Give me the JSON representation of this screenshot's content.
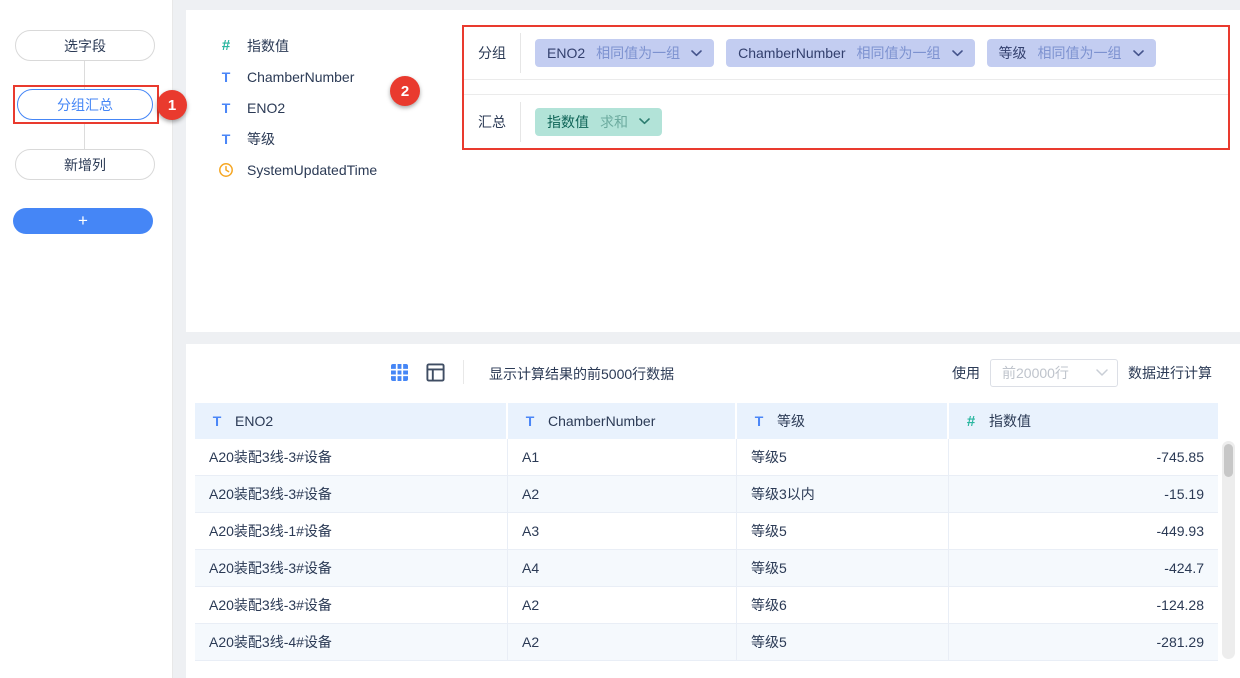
{
  "annotations": {
    "step1": "1",
    "step2": "2"
  },
  "sidebar": {
    "items": [
      {
        "label": "选字段"
      },
      {
        "label": "分组汇总"
      },
      {
        "label": "新增列"
      }
    ],
    "add_label": "+"
  },
  "fields": [
    {
      "name": "指数值",
      "type": "number"
    },
    {
      "name": "ChamberNumber",
      "type": "text"
    },
    {
      "name": "ENO2",
      "type": "text"
    },
    {
      "name": "等级",
      "type": "text"
    },
    {
      "name": "SystemUpdatedTime",
      "type": "datetime"
    }
  ],
  "group_panel": {
    "group_label": "分组",
    "group_tags": [
      {
        "field": "ENO2",
        "rule": "相同值为一组"
      },
      {
        "field": "ChamberNumber",
        "rule": "相同值为一组"
      },
      {
        "field": "等级",
        "rule": "相同值为一组"
      }
    ],
    "summary_label": "汇总",
    "summary_tags": [
      {
        "field": "指数值",
        "rule": "求和"
      }
    ]
  },
  "toolbar": {
    "result_info": "显示计算结果的前5000行数据",
    "use_prefix": "使用",
    "rows_select_value": "前20000行",
    "use_suffix": "数据进行计算"
  },
  "table": {
    "columns": [
      {
        "label": "ENO2",
        "type": "text"
      },
      {
        "label": "ChamberNumber",
        "type": "text"
      },
      {
        "label": "等级",
        "type": "text"
      },
      {
        "label": "指数值",
        "type": "number"
      }
    ],
    "rows": [
      [
        "A20装配3线-3#设备",
        "A1",
        "等级5",
        "-745.85"
      ],
      [
        "A20装配3线-3#设备",
        "A2",
        "等级3以内",
        "-15.19"
      ],
      [
        "A20装配3线-1#设备",
        "A3",
        "等级5",
        "-449.93"
      ],
      [
        "A20装配3线-3#设备",
        "A4",
        "等级5",
        "-424.7"
      ],
      [
        "A20装配3线-3#设备",
        "A2",
        "等级6",
        "-124.28"
      ],
      [
        "A20装配3线-4#设备",
        "A2",
        "等级5",
        "-281.29"
      ]
    ]
  },
  "colors": {
    "accent_blue": "#4586f6",
    "teal": "#2ab6a0",
    "orange": "#f5a623",
    "annotation_red": "#e93a2e",
    "group_tag_bg": "#c3cdf1",
    "summary_tag_bg": "#b2e3d8",
    "table_header_bg": "#e9f2fd",
    "row_alt_bg": "#f5f9fd"
  }
}
